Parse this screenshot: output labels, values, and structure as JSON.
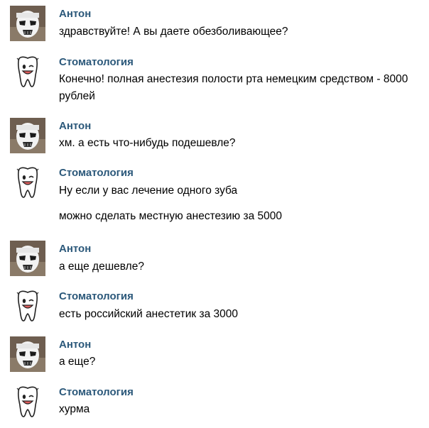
{
  "senders": {
    "user": "Антон",
    "clinic": "Стоматология"
  },
  "avatars": {
    "user": "stormtrooper-avatar",
    "clinic": "smiling-tooth-avatar"
  },
  "messages": [
    {
      "sender": "Антон",
      "lines": [
        "здравствуйте! А вы даете обезболивающее?"
      ]
    },
    {
      "sender": "Стоматология",
      "lines": [
        "Конечно! полная анестезия полости рта немецким средством - 8000",
        "рублей"
      ]
    },
    {
      "sender": "Антон",
      "lines": [
        "хм. а есть что-нибудь подешевле?"
      ]
    },
    {
      "sender": "Стоматология",
      "lines": [
        "Ну если у вас лечение одного зуба",
        "можно сделать местную анестезию за 5000"
      ]
    },
    {
      "sender": "Антон",
      "lines": [
        "а еще дешевле?"
      ]
    },
    {
      "sender": "Стоматология",
      "lines": [
        "есть российский анестетик за 3000"
      ]
    },
    {
      "sender": "Антон",
      "lines": [
        "а еще?"
      ]
    },
    {
      "sender": "Стоматология",
      "lines": [
        "хурма"
      ]
    }
  ]
}
